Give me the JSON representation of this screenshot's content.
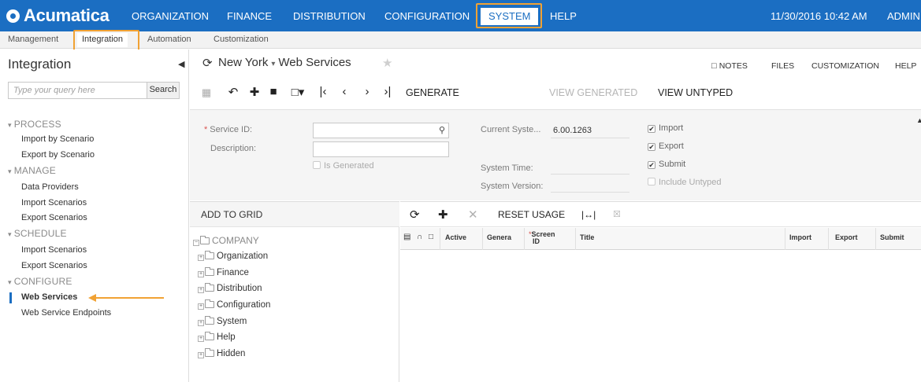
{
  "app": {
    "logo": "Acumatica",
    "top_nav": [
      "ORGANIZATION",
      "FINANCE",
      "DISTRIBUTION",
      "CONFIGURATION",
      "SYSTEM",
      "HELP"
    ],
    "datetime": "11/30/2016  10:42 AM",
    "user": "ADMIN"
  },
  "sub_nav": [
    "Management",
    "Integration",
    "Automation",
    "Customization"
  ],
  "sidebar": {
    "title": "Integration",
    "search_placeholder": "Type your query here",
    "search_button": "Search",
    "sections": [
      {
        "label": "PROCESS",
        "items": [
          "Import by Scenario",
          "Export by Scenario"
        ]
      },
      {
        "label": "MANAGE",
        "items": [
          "Data Providers",
          "Import Scenarios",
          "Export Scenarios"
        ]
      },
      {
        "label": "SCHEDULE",
        "items": [
          "Import Scenarios",
          "Export Scenarios"
        ]
      },
      {
        "label": "CONFIGURE",
        "items": [
          "Web Services",
          "Web Service Endpoints"
        ]
      }
    ],
    "selected_item": "Web Services"
  },
  "header": {
    "branch": "New York",
    "page_title": "Web Services",
    "links": [
      "NOTES",
      "FILES",
      "CUSTOMIZATION",
      "HELP"
    ]
  },
  "toolbar": {
    "generate": "GENERATE",
    "view_generated": "VIEW GENERATED",
    "view_untyped": "VIEW UNTYPED"
  },
  "form": {
    "service_id_label": "Service ID:",
    "service_id_value": "",
    "description_label": "Description:",
    "description_value": "",
    "is_generated_label": "Is Generated",
    "current_system_label": "Current Syste...",
    "current_system_value": "6.00.1263",
    "system_time_label": "System Time:",
    "system_version_label": "System Version:",
    "checkboxes": [
      {
        "label": "Import",
        "checked": true
      },
      {
        "label": "Export",
        "checked": true
      },
      {
        "label": "Submit",
        "checked": true
      },
      {
        "label": "Include Untyped",
        "checked": false
      }
    ]
  },
  "tree": {
    "header": "ADD TO GRID",
    "root": "COMPANY",
    "nodes": [
      "Organization",
      "Finance",
      "Distribution",
      "Configuration",
      "System",
      "Help",
      "Hidden"
    ]
  },
  "grid": {
    "toolbar_reset": "RESET USAGE",
    "columns": {
      "active": "Active",
      "general": "Genera",
      "screen_id_top": "Screen",
      "screen_id_bottom": "ID",
      "title": "Title",
      "import": "Import",
      "export": "Export",
      "submit": "Submit"
    }
  },
  "colors": {
    "brand_blue": "#1b6ec2",
    "highlight_orange": "#f1a234",
    "required_red": "#d9534f"
  }
}
